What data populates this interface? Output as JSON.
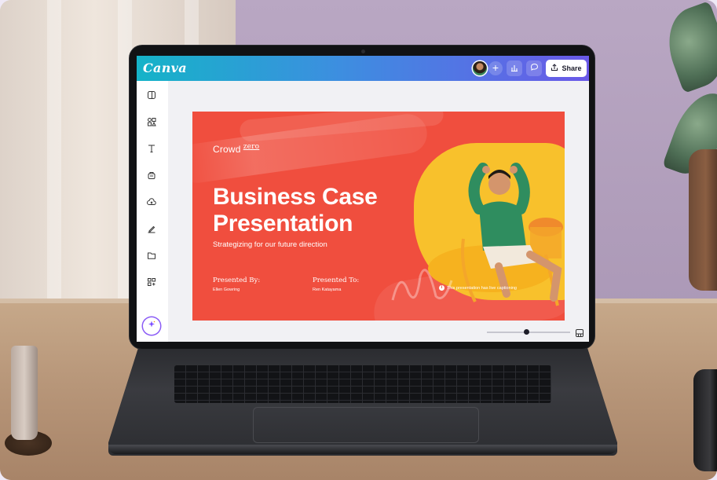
{
  "app": {
    "logo": "Canva",
    "share_label": "Share",
    "plus_label": "+"
  },
  "toolbar_icons": [
    "analytics-icon",
    "comment-icon",
    "share-upload-icon"
  ],
  "sidebar": {
    "items": [
      "design-panel-icon",
      "elements-icon",
      "text-icon",
      "brand-icon",
      "uploads-icon",
      "draw-icon",
      "projects-icon",
      "apps-icon",
      "magic-icon"
    ]
  },
  "slide": {
    "brand": "Crowd",
    "brand_suffix": "zero",
    "title_line1": "Business Case",
    "title_line2": "Presentation",
    "subtitle": "Strategizing for our future direction",
    "presented_by_label": "Presented By:",
    "presented_by_name": "Ellen Gowring",
    "presented_to_label": "Presented To:",
    "presented_to_name": "Ren Katayama",
    "caption_note": "This presentation has live captioning"
  },
  "colors": {
    "slide_bg": "#f04e3e",
    "accent_yellow": "#f8c12c",
    "topbar_start": "#15b3c8",
    "topbar_end": "#6a59e8"
  }
}
